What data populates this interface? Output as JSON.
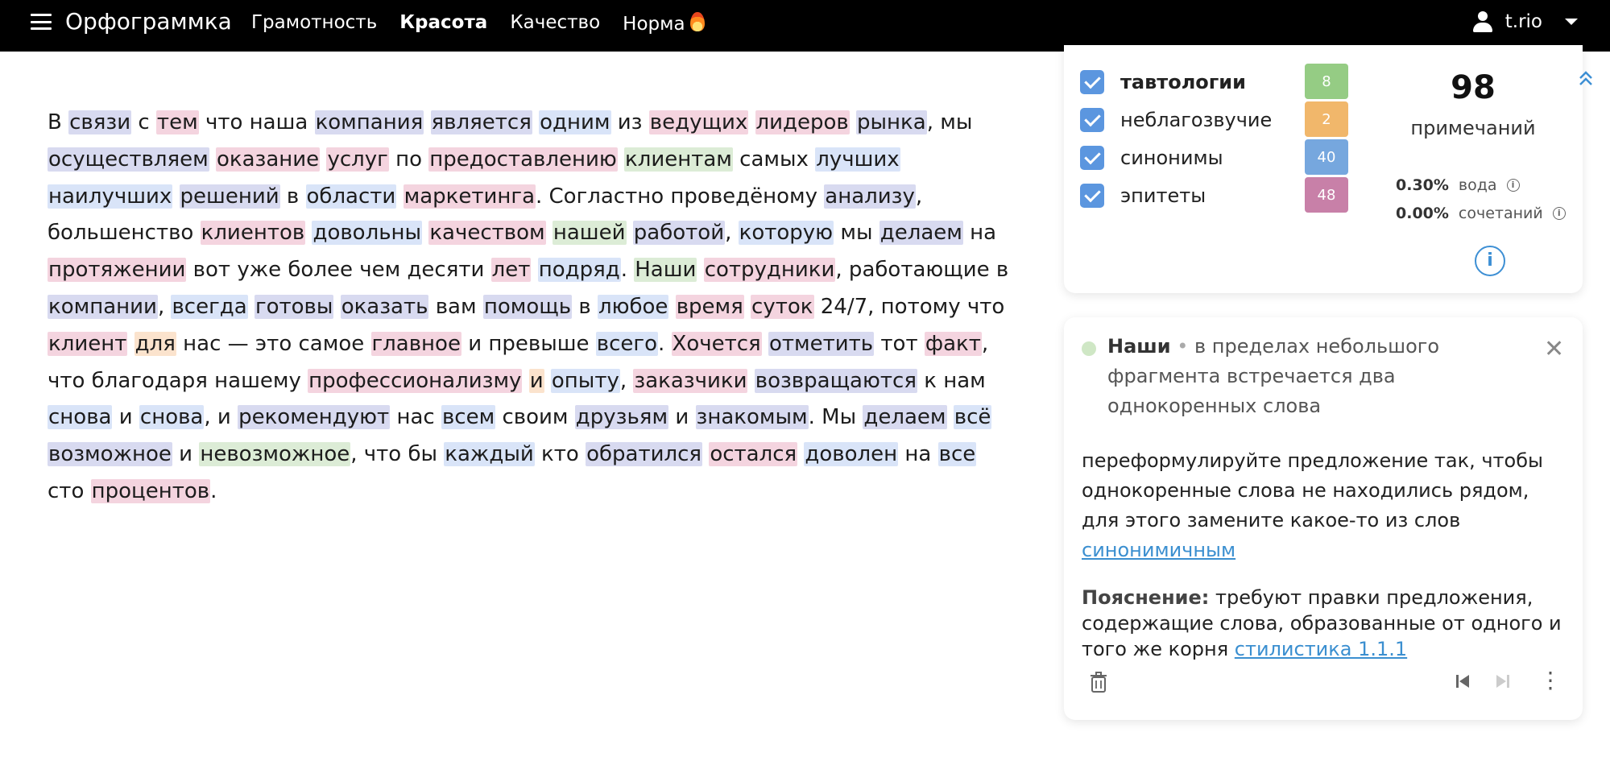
{
  "topbar": {
    "brand": "Орфограммка",
    "nav": [
      "Грамотность",
      "Красота",
      "Качество",
      "Норма"
    ],
    "active_nav": "Красота",
    "username": "t.rio"
  },
  "editor_text": [
    [
      "В ",
      ""
    ],
    [
      "связи",
      "n"
    ],
    [
      " с ",
      ""
    ],
    [
      "тем",
      "p"
    ],
    [
      " что наша ",
      ""
    ],
    [
      "компания",
      "n"
    ],
    [
      " ",
      ""
    ],
    [
      "является",
      "n"
    ],
    [
      " ",
      ""
    ],
    [
      "одним",
      "b"
    ],
    [
      " из ",
      ""
    ],
    [
      "ведущих",
      "p"
    ],
    [
      " ",
      ""
    ],
    [
      "лидеров",
      "p"
    ],
    [
      " ",
      ""
    ],
    [
      "рынка",
      "n"
    ],
    [
      ", мы ",
      ""
    ],
    [
      "осуществляем",
      "n"
    ],
    [
      " ",
      ""
    ],
    [
      "оказание",
      "p"
    ],
    [
      " ",
      ""
    ],
    [
      "услуг",
      "p"
    ],
    [
      " по ",
      ""
    ],
    [
      "предоставлению",
      "p"
    ],
    [
      " ",
      ""
    ],
    [
      "клиентам",
      "g"
    ],
    [
      " самых ",
      ""
    ],
    [
      "лучших",
      "b"
    ],
    [
      " ",
      ""
    ],
    [
      "наилучших",
      "b"
    ],
    [
      " ",
      ""
    ],
    [
      "решений",
      "n"
    ],
    [
      " в ",
      ""
    ],
    [
      "области",
      "b"
    ],
    [
      " ",
      ""
    ],
    [
      "маркетинга",
      "p"
    ],
    [
      ". Согластно проведёному ",
      ""
    ],
    [
      "анализу",
      "n"
    ],
    [
      ", большенство ",
      ""
    ],
    [
      "клиентов",
      "p"
    ],
    [
      " ",
      ""
    ],
    [
      "довольны",
      "b"
    ],
    [
      " ",
      ""
    ],
    [
      "качеством",
      "p"
    ],
    [
      " ",
      ""
    ],
    [
      "нашей",
      "g"
    ],
    [
      " ",
      ""
    ],
    [
      "работой",
      "n"
    ],
    [
      ", ",
      ""
    ],
    [
      "которую",
      "b"
    ],
    [
      " мы ",
      ""
    ],
    [
      "делаем",
      "n"
    ],
    [
      " на ",
      ""
    ],
    [
      "протяжении",
      "p"
    ],
    [
      " вот уже более ",
      ""
    ],
    [
      "чем десяти ",
      ""
    ],
    [
      "лет",
      "p"
    ],
    [
      " ",
      ""
    ],
    [
      "подряд",
      "b"
    ],
    [
      ". ",
      ""
    ],
    [
      "Наши",
      "g"
    ],
    [
      " ",
      ""
    ],
    [
      "сотрудники",
      "p"
    ],
    [
      ", работающие в ",
      ""
    ],
    [
      "компании",
      "n"
    ],
    [
      ", ",
      ""
    ],
    [
      "всегда",
      "b"
    ],
    [
      " ",
      ""
    ],
    [
      "готовы",
      "n"
    ],
    [
      " ",
      ""
    ],
    [
      "оказать",
      "n"
    ],
    [
      " вам ",
      ""
    ],
    [
      "помощь",
      "n"
    ],
    [
      " в ",
      ""
    ],
    [
      "любое",
      "b"
    ],
    [
      " ",
      ""
    ],
    [
      "время",
      "p"
    ],
    [
      " ",
      ""
    ],
    [
      "суток",
      "p"
    ],
    [
      " 24/7, потому что ",
      ""
    ],
    [
      "клиент",
      "p"
    ],
    [
      " ",
      ""
    ],
    [
      "для",
      "o"
    ],
    [
      " нас — это самое ",
      ""
    ],
    [
      "главное",
      "p"
    ],
    [
      " и превыше ",
      ""
    ],
    [
      "всего",
      "b"
    ],
    [
      ". ",
      ""
    ],
    [
      "Хочется",
      "p"
    ],
    [
      " ",
      ""
    ],
    [
      "отметить",
      "n"
    ],
    [
      " тот ",
      ""
    ],
    [
      "факт",
      "p"
    ],
    [
      ", что благодаря нашему ",
      ""
    ],
    [
      "профессионализму",
      "p"
    ],
    [
      " ",
      ""
    ],
    [
      "и",
      "o"
    ],
    [
      " ",
      ""
    ],
    [
      "опыту",
      "b"
    ],
    [
      ", ",
      ""
    ],
    [
      "заказчики",
      "p"
    ],
    [
      " ",
      ""
    ],
    [
      "возвращаются",
      "n"
    ],
    [
      " к нам ",
      ""
    ],
    [
      "снова",
      "b"
    ],
    [
      " и ",
      ""
    ],
    [
      "снова",
      "b"
    ],
    [
      ", и ",
      ""
    ],
    [
      "рекомендуют",
      "n"
    ],
    [
      " нас ",
      ""
    ],
    [
      "всем",
      "b"
    ],
    [
      " своим ",
      ""
    ],
    [
      "друзьям",
      "n"
    ],
    [
      " и ",
      ""
    ],
    [
      "знакомым",
      "n"
    ],
    [
      ". Мы ",
      ""
    ],
    [
      "делаем",
      "n"
    ],
    [
      " ",
      ""
    ],
    [
      "всё",
      "b"
    ],
    [
      " ",
      ""
    ],
    [
      "возможное",
      "n"
    ],
    [
      " и ",
      ""
    ],
    [
      "невозможное",
      "g"
    ],
    [
      ", что бы ",
      ""
    ],
    [
      "каждый",
      "b"
    ],
    [
      " кто ",
      ""
    ],
    [
      "обратился",
      "n"
    ],
    [
      " ",
      ""
    ],
    [
      "остался",
      "p"
    ],
    [
      " ",
      ""
    ],
    [
      "доволен",
      "b"
    ],
    [
      " на ",
      ""
    ],
    [
      "все",
      "b"
    ],
    [
      " сто ",
      ""
    ],
    [
      "процентов",
      "p"
    ],
    [
      ".",
      ""
    ]
  ],
  "categories": [
    {
      "label": "тавтологии",
      "count": "8",
      "color": "#95cc84"
    },
    {
      "label": "неблагозвучие",
      "count": "2",
      "color": "#f1b76b"
    },
    {
      "label": "синонимы",
      "count": "40",
      "color": "#76a7de"
    },
    {
      "label": "эпитеты",
      "count": "48",
      "color": "#c880a8"
    }
  ],
  "summary": {
    "total": "98",
    "total_label": "примечаний",
    "water_value": "0.30%",
    "water_label": "вода",
    "comb_value": "0.00%",
    "comb_label": "сочетаний"
  },
  "detail": {
    "word": "Наши",
    "bullet": "•",
    "head_text": "в пределах небольшого фрагмента встречается два однокоренных слова",
    "suggestion": "переформулируйте предложение так, чтобы однокоренные слова не находились рядом, для этого замените какое-то из слов",
    "suggestion_link": "синонимичным",
    "explanation_label": "Пояснение:",
    "explanation_text": "требуют правки предложения, содержащие слова, образованные от одного и того же корня",
    "explanation_link": "стилистика 1.1.1"
  }
}
